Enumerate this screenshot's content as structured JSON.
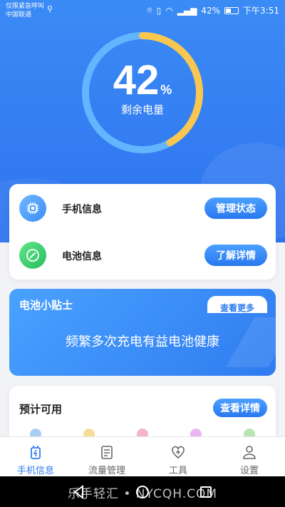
{
  "status_bar": {
    "left_line1": "仅限紧急呼叫",
    "left_line2": "中国联通",
    "battery_percent": "42%",
    "time": "下午3:51"
  },
  "gauge": {
    "value": "42",
    "unit": "%",
    "label": "剩余电量",
    "level_fraction": 0.42,
    "colors": {
      "remaining": "#f9c74f",
      "track": "#64b5ff"
    }
  },
  "info_card": {
    "phone_info": {
      "label": "手机信息",
      "button": "管理状态",
      "icon": "chip-icon"
    },
    "battery_info": {
      "label": "电池信息",
      "button": "了解详情",
      "icon": "gauge-icon"
    }
  },
  "tips": {
    "title": "电池小贴士",
    "more": "查看更多",
    "text": "频繁多次充电有益电池健康"
  },
  "estimate": {
    "title": "预计可用",
    "button": "查看详情",
    "dot_colors": [
      "#a9cdf5",
      "#f7dd98",
      "#f5b5c4",
      "#e9b7ef",
      "#b6e6b6"
    ]
  },
  "tabbar": {
    "tabs": [
      {
        "label": "手机信息",
        "icon": "battery-plug-icon",
        "active": true
      },
      {
        "label": "流量管理",
        "icon": "document-icon",
        "active": false
      },
      {
        "label": "工具",
        "icon": "heart-plus-icon",
        "active": false
      },
      {
        "label": "设置",
        "icon": "person-icon",
        "active": false
      }
    ]
  },
  "navbar": {
    "watermark": "乐手轻汇 • NYCQH.COM"
  },
  "colors": {
    "accent": "#2f7bf0",
    "hero_blue": "#3b8bf5"
  }
}
